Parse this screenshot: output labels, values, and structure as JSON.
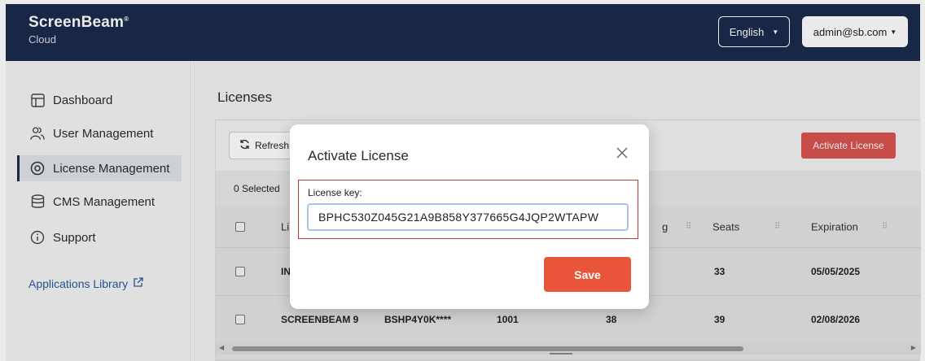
{
  "header": {
    "brand_name": "ScreenBeam",
    "brand_mark": "®",
    "brand_sub": "Cloud",
    "language": "English",
    "user": "admin@sb.com"
  },
  "sidebar": {
    "items": [
      {
        "label": "Dashboard",
        "icon": "layout-icon",
        "active": false
      },
      {
        "label": "User Management",
        "icon": "users-icon",
        "active": false
      },
      {
        "label": "License Management",
        "icon": "target-icon",
        "active": true
      },
      {
        "label": "CMS Management",
        "icon": "database-icon",
        "active": false
      },
      {
        "label": "Support",
        "icon": "info-icon",
        "active": false
      }
    ],
    "apps_link": "Applications Library"
  },
  "main": {
    "page_title": "Licenses",
    "refresh_label": "Refresh",
    "activate_label": "Activate License",
    "selected_text": "0 Selected",
    "columns": [
      "Li",
      "g",
      "Seats",
      "Expiration"
    ],
    "rows": [
      {
        "c1": "IN",
        "seats": "33",
        "expiration": "05/05/2025"
      },
      {
        "c1": "SCREENBEAM 9",
        "c2": "BSHP4Y0K****",
        "c3": "1001",
        "c4": "38",
        "seats": "39",
        "expiration": "02/08/2026"
      }
    ]
  },
  "modal": {
    "title": "Activate License",
    "key_label": "License key:",
    "key_value": "BPHC530Z045G21A9B858Y377665G4JQP2WTAPW",
    "save_label": "Save"
  },
  "colors": {
    "header_bg": "#1c2b4d",
    "accent_red": "#e8553a",
    "activate_btn": "#d9534f",
    "link_blue": "#2a5aa0"
  }
}
